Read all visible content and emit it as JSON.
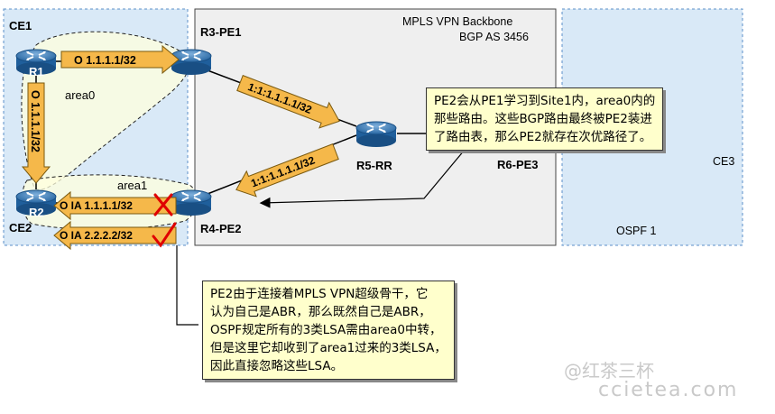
{
  "zones": {
    "left_label": "CE1",
    "left_label2": "CE2",
    "backbone_title": "MPLS VPN Backbone",
    "backbone_as": "BGP AS 3456",
    "right_label": "CE3",
    "right_ospf": "OSPF 1"
  },
  "routers": {
    "r1": "R1",
    "r2": "R2",
    "r3": "R3-PE1",
    "r4": "R4-PE2",
    "r5": "R5-RR",
    "r6": "R6-PE3"
  },
  "areas": {
    "area0": "area0",
    "area1": "area1"
  },
  "arrows": {
    "ce1_to_pe1": "O  1.1.1.1/32",
    "r1_to_r2": "O  1.1.1.1/32",
    "pe1_to_rr": "1:1:1.1.1.1/32",
    "rr_to_pe2": "1:1:1.1.1.1/32",
    "pe2_to_ce2_a": "O IA  1.1.1.1/32",
    "pe2_to_ce2_b": "O IA  2.2.2.2/32"
  },
  "callout_top": [
    "PE2会从PE1学习到Site1内，area0内的",
    "那些路由。这些BGP路由最终被PE2装进",
    "了路由表，那么PE2就存在次优路径了。"
  ],
  "callout_bottom": [
    "PE2由于连接着MPLS VPN超级骨干，它",
    "认为自己是ABR，那么既然自己是ABR，",
    "OSPF规定所有的3类LSA需由area0中转，",
    "但是这里它却收到了area1过来的3类LSA，",
    "因此直接忽略这些LSA。"
  ],
  "watermark": {
    "brand": "@红茶三杯",
    "site": "ccietea.com"
  },
  "colors": {
    "ce_zone": "#d9e9f7",
    "backbone": "#efefef",
    "arrow": "#f5b84a",
    "callout": "#ffffcc",
    "cross": "#e00000"
  }
}
